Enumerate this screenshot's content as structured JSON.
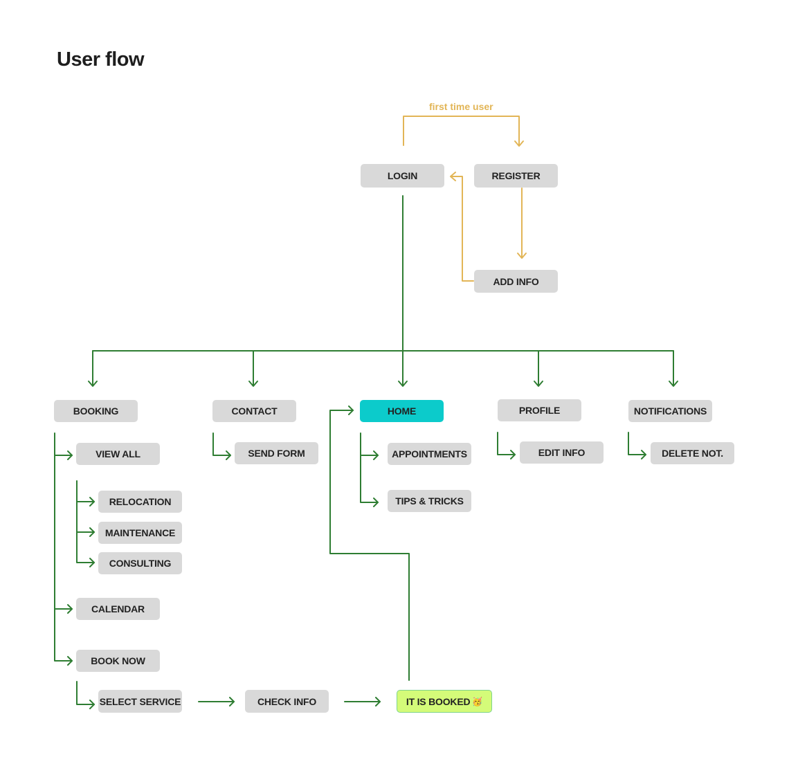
{
  "title": "User flow",
  "annotation_first_time_user": "first time user",
  "colors": {
    "primary_line": "#2e7d32",
    "auth_line": "#e2b556",
    "home": "#0ccbcb",
    "booked": "#d4fb79",
    "node": "#d9d9d9"
  },
  "nodes": {
    "login": "LOGIN",
    "register": "REGISTER",
    "add_info": "ADD INFO",
    "booking": "BOOKING",
    "contact": "CONTACT",
    "home": "HOME",
    "profile": "PROFILE",
    "notifications": "NOTIFICATIONS",
    "view_all": "VIEW ALL",
    "relocation": "RELOCATION",
    "maintenance": "MAINTENANCE",
    "consulting": "CONSULTING",
    "calendar": "CALENDAR",
    "book_now": "BOOK NOW",
    "select_service": "SELECT SERVICE",
    "check_info": "CHECK INFO",
    "it_is_booked": "IT IS BOOKED",
    "it_is_booked_emoji": "🥳",
    "send_form": "SEND FORM",
    "appointments": "APPOINTMENTS",
    "tips_tricks": "TIPS & TRICKS",
    "edit_info": "EDIT INFO",
    "delete_not": "DELETE NOT."
  }
}
